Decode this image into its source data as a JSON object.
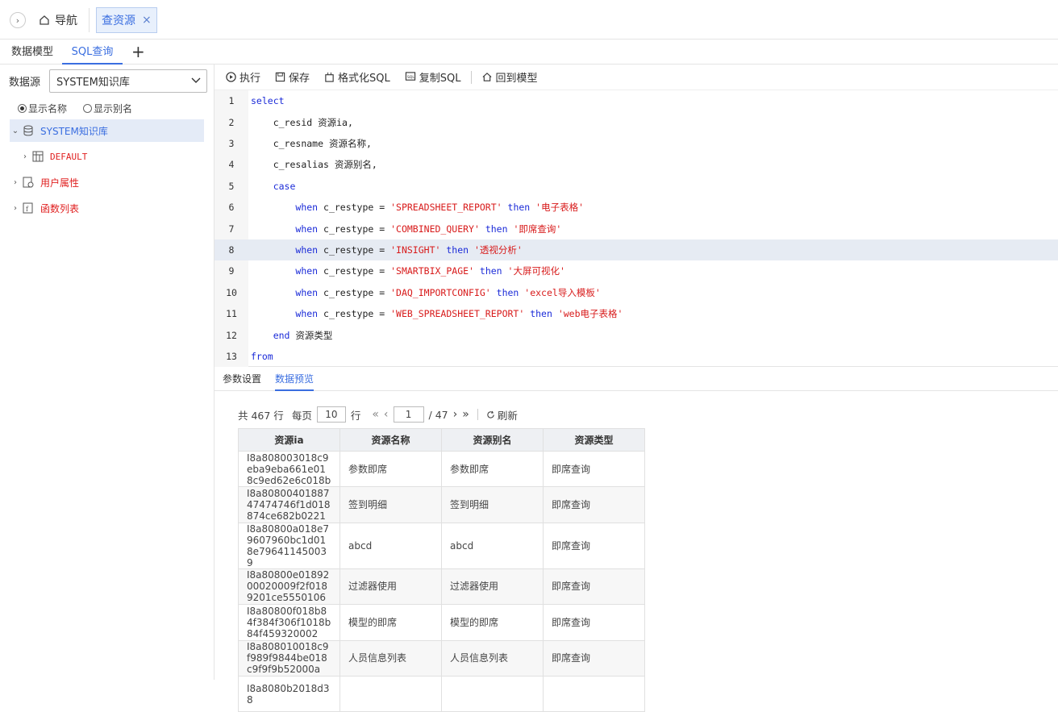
{
  "topbar": {
    "nav_label": "导航",
    "active_tab": "查资源",
    "close_glyph": "×"
  },
  "subtabs": {
    "tab1": "数据模型",
    "tab2": "SQL查询",
    "add": "+"
  },
  "sidebar": {
    "datasource_label": "数据源",
    "datasource_value": "SYSTEM知识库",
    "radio_name": "显示名称",
    "radio_alias": "显示别名",
    "tree": {
      "root": "SYSTEM知识库",
      "default": "DEFAULT",
      "user_attr": "用户属性",
      "func_list": "函数列表"
    }
  },
  "toolbar": {
    "run": "执行",
    "save": "保存",
    "format": "格式化SQL",
    "copy": "复制SQL",
    "back": "回到模型"
  },
  "editor": {
    "lines": [
      {
        "n": "1",
        "indent": "",
        "kw1": "select",
        "mid": "",
        "str1": "",
        "kw2": "",
        "str2": ""
      },
      {
        "n": "2",
        "indent": "    ",
        "kw1": "",
        "mid": "c_resid 资源ia,",
        "str1": "",
        "kw2": "",
        "str2": ""
      },
      {
        "n": "3",
        "indent": "    ",
        "kw1": "",
        "mid": "c_resname 资源名称,",
        "str1": "",
        "kw2": "",
        "str2": ""
      },
      {
        "n": "4",
        "indent": "    ",
        "kw1": "",
        "mid": "c_resalias 资源别名,",
        "str1": "",
        "kw2": "",
        "str2": ""
      },
      {
        "n": "5",
        "indent": "    ",
        "kw1": "case",
        "mid": "",
        "str1": "",
        "kw2": "",
        "str2": ""
      },
      {
        "n": "6",
        "indent": "        ",
        "kw1": "when",
        "mid": " c_restype = ",
        "str1": "'SPREADSHEET_REPORT'",
        "kw2": " then ",
        "str2": "'电子表格'"
      },
      {
        "n": "7",
        "indent": "        ",
        "kw1": "when",
        "mid": " c_restype = ",
        "str1": "'COMBINED_QUERY'",
        "kw2": " then ",
        "str2": "'即席查询'"
      },
      {
        "n": "8",
        "indent": "        ",
        "kw1": "when",
        "mid": " c_restype = ",
        "str1": "'INSIGHT'",
        "kw2": " then ",
        "str2": "'透视分析'"
      },
      {
        "n": "9",
        "indent": "        ",
        "kw1": "when",
        "mid": " c_restype = ",
        "str1": "'SMARTBIX_PAGE'",
        "kw2": " then ",
        "str2": "'大屏可视化'"
      },
      {
        "n": "10",
        "indent": "        ",
        "kw1": "when",
        "mid": " c_restype = ",
        "str1": "'DAQ_IMPORTCONFIG'",
        "kw2": " then ",
        "str2": "'excel导入模板'"
      },
      {
        "n": "11",
        "indent": "        ",
        "kw1": "when",
        "mid": " c_restype = ",
        "str1": "'WEB_SPREADSHEET_REPORT'",
        "kw2": " then ",
        "str2": "'web电子表格'"
      },
      {
        "n": "12",
        "indent": "    ",
        "kw1": "end",
        "mid": " 资源类型",
        "str1": "",
        "kw2": "",
        "str2": ""
      },
      {
        "n": "13",
        "indent": "",
        "kw1": "from",
        "mid": "",
        "str1": "",
        "kw2": "",
        "str2": ""
      }
    ]
  },
  "panel_tabs": {
    "params": "参数设置",
    "preview": "数据预览"
  },
  "pager": {
    "total": "共 467 行",
    "per_page_label": "每页",
    "per_page": "10",
    "rows_unit": "行",
    "first": "«",
    "prev": "‹",
    "page": "1",
    "of_pages": "/ 47",
    "next": "›",
    "last": "»",
    "refresh": "刷新"
  },
  "table": {
    "headers": [
      "资源ia",
      "资源名称",
      "资源别名",
      "资源类型"
    ],
    "rows": [
      [
        "I8a808003018c9eba9eba661e018c9ed62e6c018b",
        "参数即席",
        "参数即席",
        "即席查询"
      ],
      [
        "I8a8080040188747474746f1d018874ce682b0221",
        "签到明细",
        "签到明细",
        "即席查询"
      ],
      [
        "I8a80800a018e79607960bc1d018e796411450039",
        "abcd",
        "abcd",
        "即席查询"
      ],
      [
        "I8a80800e0189200020009f2f0189201ce5550106",
        "过滤器使用",
        "过滤器使用",
        "即席查询"
      ],
      [
        "I8a80800f018b84f384f306f1018b84f459320002",
        "模型的即席",
        "模型的即席",
        "即席查询"
      ],
      [
        "I8a808010018c9f989f9844be018c9f9f9b52000a",
        "人员信息列表",
        "人员信息列表",
        "即席查询"
      ],
      [
        "I8a8080b2018d38",
        "",
        "",
        ""
      ]
    ]
  }
}
